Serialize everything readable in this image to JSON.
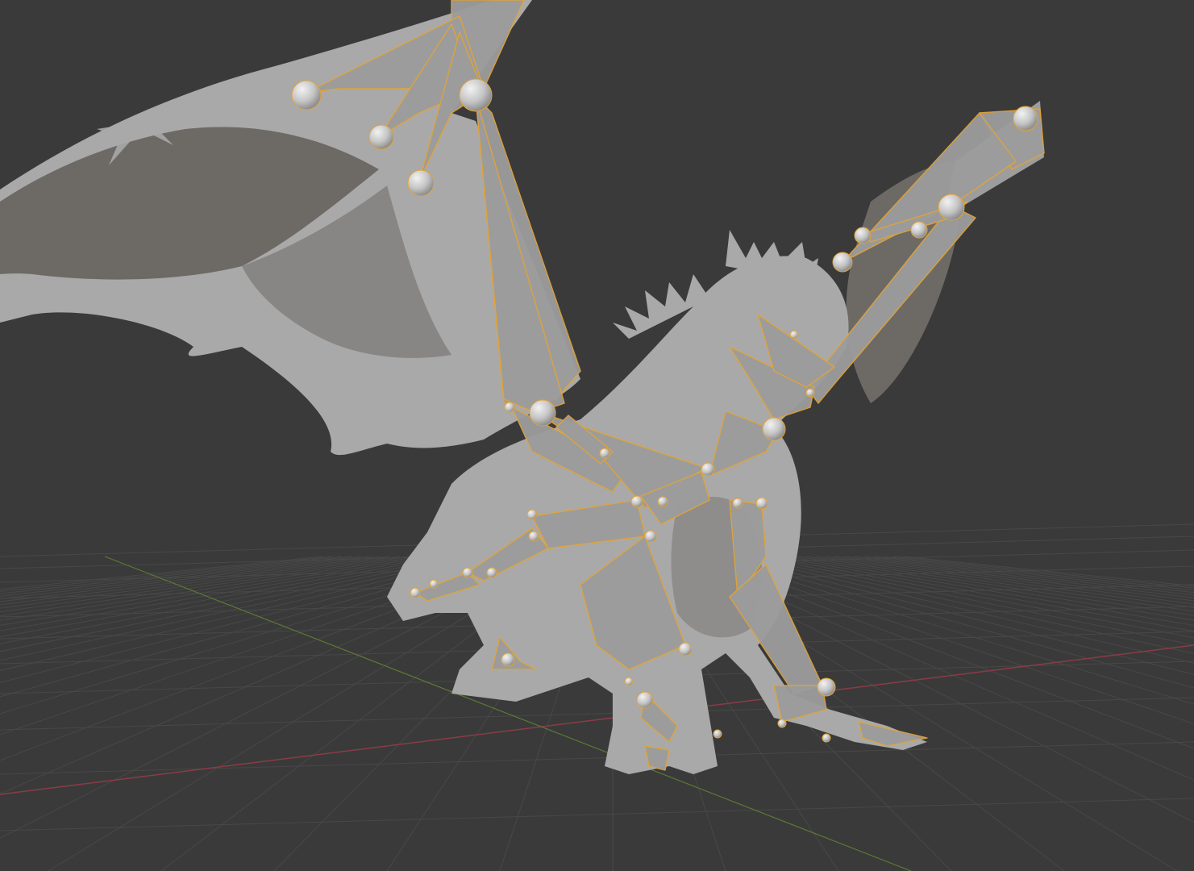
{
  "viewport": {
    "background": "#3a3a3a",
    "grid_color": "#484848",
    "axis_x_color": "#8a3c46",
    "axis_y_color": "#5c7a35",
    "mesh_color": "#a9a9a9",
    "mesh_shadow_color": "#6d6a66",
    "bone_color": "#9c9c9c",
    "bone_outline_color": "#e0a43a",
    "joint_color": "#cfcfcf"
  }
}
